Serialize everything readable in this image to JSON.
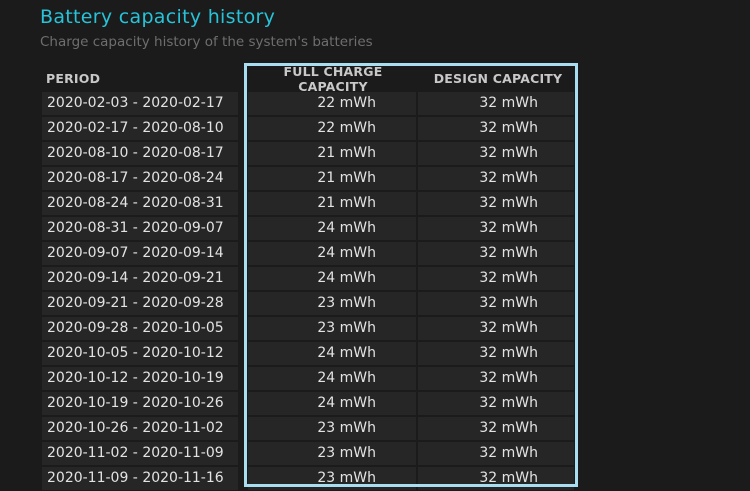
{
  "report": {
    "title": "Battery capacity history",
    "subtitle": "Charge capacity history of the system's batteries"
  },
  "table": {
    "headers": {
      "period": "PERIOD",
      "full_charge_capacity": "FULL CHARGE CAPACITY",
      "design_capacity": "DESIGN CAPACITY"
    },
    "rows": [
      {
        "period": "2020-02-03 - 2020-02-17",
        "full": "22 mWh",
        "design": "32 mWh"
      },
      {
        "period": "2020-02-17 - 2020-08-10",
        "full": "22 mWh",
        "design": "32 mWh"
      },
      {
        "period": "2020-08-10 - 2020-08-17",
        "full": "21 mWh",
        "design": "32 mWh"
      },
      {
        "period": "2020-08-17 - 2020-08-24",
        "full": "21 mWh",
        "design": "32 mWh"
      },
      {
        "period": "2020-08-24 - 2020-08-31",
        "full": "21 mWh",
        "design": "32 mWh"
      },
      {
        "period": "2020-08-31 - 2020-09-07",
        "full": "24 mWh",
        "design": "32 mWh"
      },
      {
        "period": "2020-09-07 - 2020-09-14",
        "full": "24 mWh",
        "design": "32 mWh"
      },
      {
        "period": "2020-09-14 - 2020-09-21",
        "full": "24 mWh",
        "design": "32 mWh"
      },
      {
        "period": "2020-09-21 - 2020-09-28",
        "full": "23 mWh",
        "design": "32 mWh"
      },
      {
        "period": "2020-09-28 - 2020-10-05",
        "full": "23 mWh",
        "design": "32 mWh"
      },
      {
        "period": "2020-10-05 - 2020-10-12",
        "full": "24 mWh",
        "design": "32 mWh"
      },
      {
        "period": "2020-10-12 - 2020-10-19",
        "full": "24 mWh",
        "design": "32 mWh"
      },
      {
        "period": "2020-10-19 - 2020-10-26",
        "full": "24 mWh",
        "design": "32 mWh"
      },
      {
        "period": "2020-10-26 - 2020-11-02",
        "full": "23 mWh",
        "design": "32 mWh"
      },
      {
        "period": "2020-11-02 - 2020-11-09",
        "full": "23 mWh",
        "design": "32 mWh"
      },
      {
        "period": "2020-11-09 - 2020-11-16",
        "full": "23 mWh",
        "design": "32 mWh"
      }
    ]
  },
  "highlight": {
    "color": "#a9def0"
  },
  "colors": {
    "title": "#27c3d9",
    "background": "#1b1b1b",
    "cell": "#262626"
  }
}
